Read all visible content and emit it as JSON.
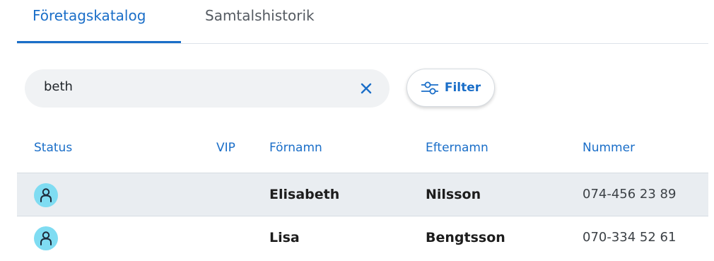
{
  "tabs": [
    {
      "label": "Företagskatalog",
      "active": true
    },
    {
      "label": "Samtalshistorik",
      "active": false
    }
  ],
  "search": {
    "value": "beth",
    "clear_icon": "close-icon"
  },
  "filter": {
    "label": "Filter",
    "icon": "sliders-icon"
  },
  "table": {
    "headers": {
      "status": "Status",
      "vip": "VIP",
      "first_name": "Förnamn",
      "last_name": "Efternamn",
      "number": "Nummer"
    },
    "rows": [
      {
        "status_icon": "person-icon",
        "first_name": "Elisabeth",
        "last_name": "Nilsson",
        "number": "074-456 23 89",
        "highlighted": true
      },
      {
        "status_icon": "person-icon",
        "first_name": "Lisa",
        "last_name": "Bengtsson",
        "number": "070-334 52 61",
        "highlighted": false
      }
    ]
  },
  "colors": {
    "accent": "#1a6ec8",
    "avatar": "#7fdcf2",
    "row_highlight": "#e9edf1"
  }
}
